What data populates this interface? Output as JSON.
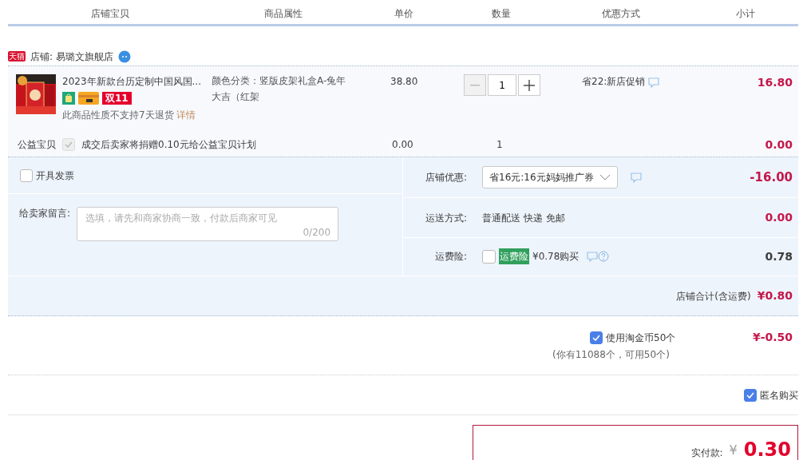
{
  "columns": [
    "店铺宝贝",
    "商品属性",
    "单价",
    "数量",
    "优惠方式",
    "小计"
  ],
  "shop": {
    "badge": "天猫",
    "label": "店铺: 易璐文旗舰店"
  },
  "item": {
    "title": "2023年新款台历定制中国风国...",
    "badge": "双11",
    "return_note": "此商品性质不支持7天退货",
    "details_link": "详情",
    "attribute": "颜色分类：竖版皮架礼盒A-兔年大吉（红架",
    "price": "38.80",
    "quantity": "1",
    "promotion": "省22:新店促销",
    "subtotal": "16.80"
  },
  "charity": {
    "label": "公益宝贝",
    "checked": true,
    "disabled": true,
    "text": "成交后卖家将捐赠0.10元给公益宝贝计划",
    "price": "0.00",
    "quantity": "1",
    "subtotal": "0.00"
  },
  "invoice": {
    "label": "开具发票",
    "checked": false
  },
  "message": {
    "label": "给卖家留言:",
    "placeholder": "选填，请先和商家协商一致，付款后商家可见",
    "counter": "0/200"
  },
  "coupon": {
    "label": "店铺优惠:",
    "value": "省16元:16元妈妈推广券",
    "amount": "-16.00"
  },
  "shipping": {
    "label": "运送方式:",
    "value": "普通配送 快递 免邮",
    "amount": "0.00"
  },
  "insurance": {
    "label": "运费险:",
    "checked": false,
    "tag": "运费险",
    "price": "¥0.78购买",
    "amount": "0.78"
  },
  "shop_total": {
    "label": "店铺合计(含运费)",
    "amount": "¥0.80"
  },
  "coins": {
    "label": "使用淘金币50个",
    "checked": true,
    "note": "(你有11088个，可用50个)",
    "amount": "¥-0.50"
  },
  "anonymous": {
    "label": "匿名购买",
    "checked": true
  },
  "payment": {
    "label": "实付款:",
    "currency": "¥",
    "amount": "0.30"
  }
}
